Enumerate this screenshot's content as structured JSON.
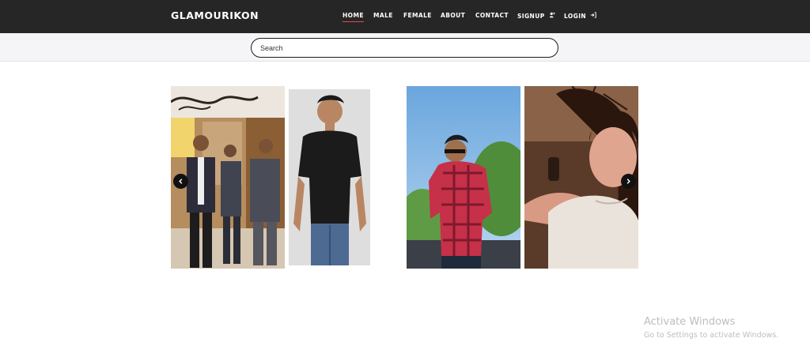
{
  "brand": "GLAMOURIKON",
  "nav": {
    "items": [
      {
        "label": "HOME",
        "active": true
      },
      {
        "label": "MALE"
      },
      {
        "label": "FEMALE"
      },
      {
        "label": "ABOUT"
      },
      {
        "label": "CONTACT"
      },
      {
        "label": "SIGNUP",
        "icon": "user-plus-icon",
        "glyph": "👤"
      },
      {
        "label": "LOGIN",
        "icon": "login-icon",
        "glyph": "⇥"
      }
    ]
  },
  "search": {
    "placeholder": "Search"
  },
  "carousel": {
    "photos": [
      {
        "name": "photo-group-of-three-men",
        "palette": {
          "bg": "#a4865f",
          "accent": "#2e2f3a"
        }
      },
      {
        "name": "photo-man-black-tshirt",
        "palette": {
          "bg": "#dcdcdc",
          "accent": "#1e1e1e"
        }
      },
      {
        "name": "photo-man-red-plaid-shirt",
        "palette": {
          "bg": "#7fb4e3",
          "accent": "#c0263f"
        }
      },
      {
        "name": "photo-woman-selfie",
        "palette": {
          "bg": "#6b4a35",
          "accent": "#e6d8cc"
        }
      }
    ],
    "prev_icon": "chevron-left-icon",
    "next_icon": "chevron-right-icon"
  },
  "watermark": {
    "title": "Activate Windows",
    "subtitle": "Go to Settings to activate Windows."
  }
}
